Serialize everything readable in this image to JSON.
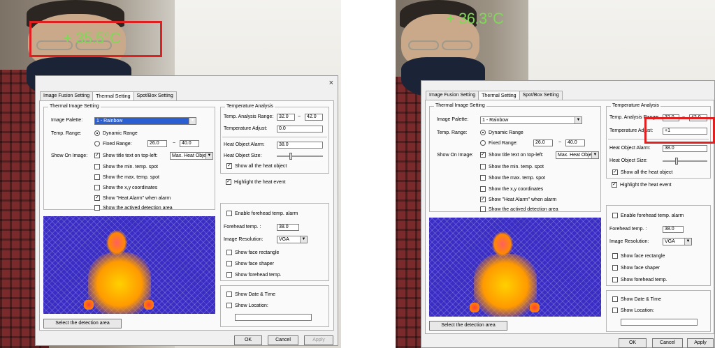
{
  "left": {
    "temperature_overlay": "+ 35.5°C",
    "dialog": {
      "close_label": "×",
      "tabs": [
        "Image Fusion Setting",
        "Thermal Setting",
        "Spot/Box Setting"
      ],
      "thermal_image_setting": {
        "group_title": "Thermal Image Setting",
        "image_palette_label": "Image Palette:",
        "image_palette_value": "1 - Rainbow",
        "temp_range_label": "Temp. Range:",
        "dynamic_range_label": "Dynamic Range",
        "fixed_range_label": "Fixed Range:",
        "fixed_min": "26.0",
        "fixed_sep": "~",
        "fixed_max": "40.0",
        "show_on_image_label": "Show On Image:",
        "show_title_text": "Show title text on top-left:",
        "title_object_value": "Max. Heat Object",
        "show_min_spot": "Show the min. temp. spot",
        "show_max_spot": "Show the max. temp. spot",
        "show_xy": "Show the x,y coordinates",
        "show_heat_alarm": "Show \"Heat Alarm\" when alarm",
        "show_detection_area": "Show the actived detection area"
      },
      "select_area_button": "Select the detection area",
      "temperature_analysis": {
        "group_title": "Temperature Analysis",
        "analysis_range_label": "Temp. Analysis Range:",
        "range_min": "32.0",
        "range_sep": "~",
        "range_max": "42.0",
        "temp_adjust_label": "Temperature Adjust:",
        "temp_adjust_value": "0.0",
        "heat_alarm_label": "Heat Object Alarm:",
        "heat_alarm_value": "38.0",
        "heat_size_label": "Heat Object Size:",
        "show_all_heat": "Show all the heat object",
        "highlight_heat": "Highlight the heat event"
      },
      "forehead": {
        "enable_alarm": "Enable forehead temp. alarm",
        "forehead_temp_label": "Forehead temp. :",
        "forehead_temp_value": "38.0",
        "resolution_label": "Image Resolution:",
        "resolution_value": "VGA",
        "show_face_rect": "Show face rectangle",
        "show_face_shaper": "Show face shaper",
        "show_forehead_temp": "Show forehead temp."
      },
      "date_location": {
        "show_date_time": "Show Date & Time",
        "show_location": "Show Location:"
      },
      "buttons": {
        "ok": "OK",
        "cancel": "Cancel",
        "apply": "Apply"
      }
    }
  },
  "right": {
    "temperature_overlay": "+ 36.3°C",
    "dialog": {
      "tabs": [
        "Image Fusion Setting",
        "Thermal Setting",
        "Spot/Box Setting"
      ],
      "thermal_image_setting": {
        "group_title": "Thermal Image Setting",
        "image_palette_label": "Image Palette:",
        "image_palette_value": "1 - Rainbow",
        "temp_range_label": "Temp. Range:",
        "dynamic_range_label": "Dynamic Range",
        "fixed_range_label": "Fixed Range:",
        "fixed_min": "26.0",
        "fixed_sep": "~",
        "fixed_max": "40.0",
        "show_on_image_label": "Show On Image:",
        "show_title_text": "Show title text on top-left:",
        "title_object_value": "Max. Heat Object",
        "show_min_spot": "Show the min. temp. spot",
        "show_max_spot": "Show the max. temp. spot",
        "show_xy": "Show the x,y coordinates",
        "show_heat_alarm": "Show \"Heat Alarm\" when alarm",
        "show_detection_area": "Show the actived detection area"
      },
      "select_area_button": "Select the detection area",
      "temperature_analysis": {
        "group_title": "Temperature Analysis",
        "analysis_range_label": "Temp. Analysis Range:",
        "range_min": "32.0",
        "range_sep": "~",
        "range_max": "42.0",
        "temp_adjust_label": "Temperature Adjust:",
        "temp_adjust_value": "+1",
        "heat_alarm_label": "Heat Object Alarm:",
        "heat_alarm_value": "38.0",
        "heat_size_label": "Heat Object Size:",
        "show_all_heat": "Show all the heat object",
        "highlight_heat": "Highlight the heat event"
      },
      "forehead": {
        "enable_alarm": "Enable forehead temp. alarm",
        "forehead_temp_label": "Forehead temp. :",
        "forehead_temp_value": "38.0",
        "resolution_label": "Image Resolution:",
        "resolution_value": "VGA",
        "show_face_rect": "Show face rectangle",
        "show_face_shaper": "Show face shaper",
        "show_forehead_temp": "Show forehead temp."
      },
      "date_location": {
        "show_date_time": "Show Date & Time",
        "show_location": "Show Location:"
      },
      "buttons": {
        "ok": "OK",
        "cancel": "Cancel",
        "apply": "Apply"
      }
    }
  },
  "colors": {
    "overlay_text": "#7ed957",
    "highlight_box": "#e02020",
    "thermal_bg": "#3a2dc4"
  }
}
